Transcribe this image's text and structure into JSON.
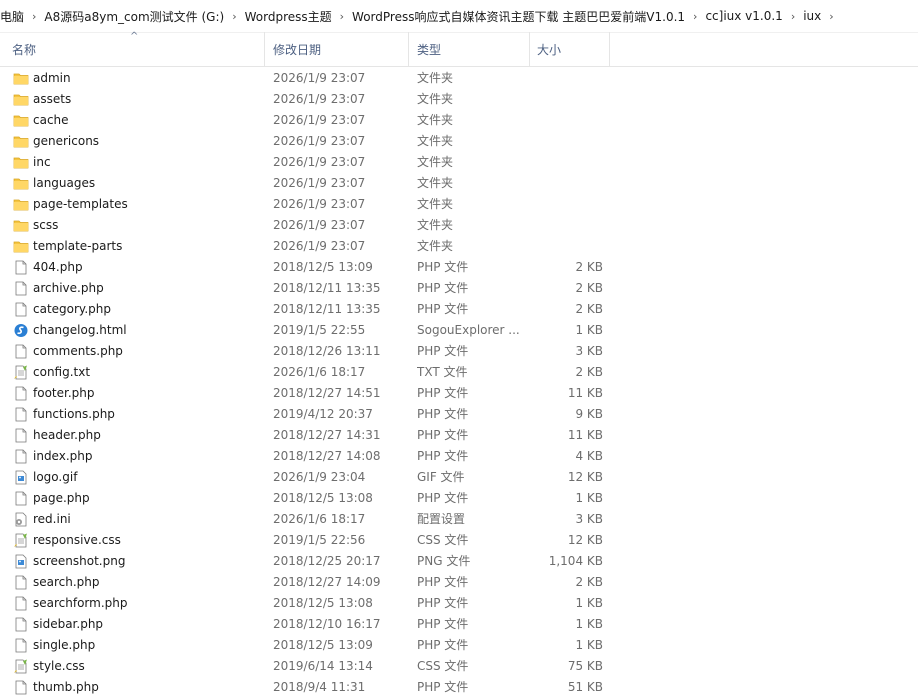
{
  "breadcrumb": [
    "电脑",
    "A8源码a8ym_com测试文件 (G:)",
    "Wordpress主题",
    "WordPress响应式自媒体资讯主题下载 主题巴巴爱前端V1.0.1",
    "cc]iux v1.0.1",
    "iux"
  ],
  "columns": {
    "name": "名称",
    "date": "修改日期",
    "type": "类型",
    "size": "大小"
  },
  "colors": {
    "folder": "#f5c542",
    "header_text": "#4d6082",
    "secondary_text": "#6d6d6d"
  },
  "files": [
    {
      "name": "admin",
      "date": "2026/1/9 23:07",
      "type": "文件夹",
      "size": "",
      "icon": "folder-icon"
    },
    {
      "name": "assets",
      "date": "2026/1/9 23:07",
      "type": "文件夹",
      "size": "",
      "icon": "folder-icon"
    },
    {
      "name": "cache",
      "date": "2026/1/9 23:07",
      "type": "文件夹",
      "size": "",
      "icon": "folder-icon"
    },
    {
      "name": "genericons",
      "date": "2026/1/9 23:07",
      "type": "文件夹",
      "size": "",
      "icon": "folder-icon"
    },
    {
      "name": "inc",
      "date": "2026/1/9 23:07",
      "type": "文件夹",
      "size": "",
      "icon": "folder-icon"
    },
    {
      "name": "languages",
      "date": "2026/1/9 23:07",
      "type": "文件夹",
      "size": "",
      "icon": "folder-icon"
    },
    {
      "name": "page-templates",
      "date": "2026/1/9 23:07",
      "type": "文件夹",
      "size": "",
      "icon": "folder-icon"
    },
    {
      "name": "scss",
      "date": "2026/1/9 23:07",
      "type": "文件夹",
      "size": "",
      "icon": "folder-icon"
    },
    {
      "name": "template-parts",
      "date": "2026/1/9 23:07",
      "type": "文件夹",
      "size": "",
      "icon": "folder-icon"
    },
    {
      "name": "404.php",
      "date": "2018/12/5 13:09",
      "type": "PHP 文件",
      "size": "2 KB",
      "icon": "file-icon"
    },
    {
      "name": "archive.php",
      "date": "2018/12/11 13:35",
      "type": "PHP 文件",
      "size": "2 KB",
      "icon": "file-icon"
    },
    {
      "name": "category.php",
      "date": "2018/12/11 13:35",
      "type": "PHP 文件",
      "size": "2 KB",
      "icon": "file-icon"
    },
    {
      "name": "changelog.html",
      "date": "2019/1/5 22:55",
      "type": "SogouExplorer ...",
      "size": "1 KB",
      "icon": "html-icon"
    },
    {
      "name": "comments.php",
      "date": "2018/12/26 13:11",
      "type": "PHP 文件",
      "size": "3 KB",
      "icon": "file-icon"
    },
    {
      "name": "config.txt",
      "date": "2026/1/6 18:17",
      "type": "TXT 文件",
      "size": "2 KB",
      "icon": "text-icon"
    },
    {
      "name": "footer.php",
      "date": "2018/12/27 14:51",
      "type": "PHP 文件",
      "size": "11 KB",
      "icon": "file-icon"
    },
    {
      "name": "functions.php",
      "date": "2019/4/12 20:37",
      "type": "PHP 文件",
      "size": "9 KB",
      "icon": "file-icon"
    },
    {
      "name": "header.php",
      "date": "2018/12/27 14:31",
      "type": "PHP 文件",
      "size": "11 KB",
      "icon": "file-icon"
    },
    {
      "name": "index.php",
      "date": "2018/12/27 14:08",
      "type": "PHP 文件",
      "size": "4 KB",
      "icon": "file-icon"
    },
    {
      "name": "logo.gif",
      "date": "2026/1/9 23:04",
      "type": "GIF 文件",
      "size": "12 KB",
      "icon": "image-icon"
    },
    {
      "name": "page.php",
      "date": "2018/12/5 13:08",
      "type": "PHP 文件",
      "size": "1 KB",
      "icon": "file-icon"
    },
    {
      "name": "red.ini",
      "date": "2026/1/6 18:17",
      "type": "配置设置",
      "size": "3 KB",
      "icon": "settings-file-icon"
    },
    {
      "name": "responsive.css",
      "date": "2019/1/5 22:56",
      "type": "CSS 文件",
      "size": "12 KB",
      "icon": "text-icon"
    },
    {
      "name": "screenshot.png",
      "date": "2018/12/25 20:17",
      "type": "PNG 文件",
      "size": "1,104 KB",
      "icon": "image-icon"
    },
    {
      "name": "search.php",
      "date": "2018/12/27 14:09",
      "type": "PHP 文件",
      "size": "2 KB",
      "icon": "file-icon"
    },
    {
      "name": "searchform.php",
      "date": "2018/12/5 13:08",
      "type": "PHP 文件",
      "size": "1 KB",
      "icon": "file-icon"
    },
    {
      "name": "sidebar.php",
      "date": "2018/12/10 16:17",
      "type": "PHP 文件",
      "size": "1 KB",
      "icon": "file-icon"
    },
    {
      "name": "single.php",
      "date": "2018/12/5 13:09",
      "type": "PHP 文件",
      "size": "1 KB",
      "icon": "file-icon"
    },
    {
      "name": "style.css",
      "date": "2019/6/14 13:14",
      "type": "CSS 文件",
      "size": "75 KB",
      "icon": "text-icon"
    },
    {
      "name": "thumb.php",
      "date": "2018/9/4 11:31",
      "type": "PHP 文件",
      "size": "51 KB",
      "icon": "file-icon"
    }
  ]
}
